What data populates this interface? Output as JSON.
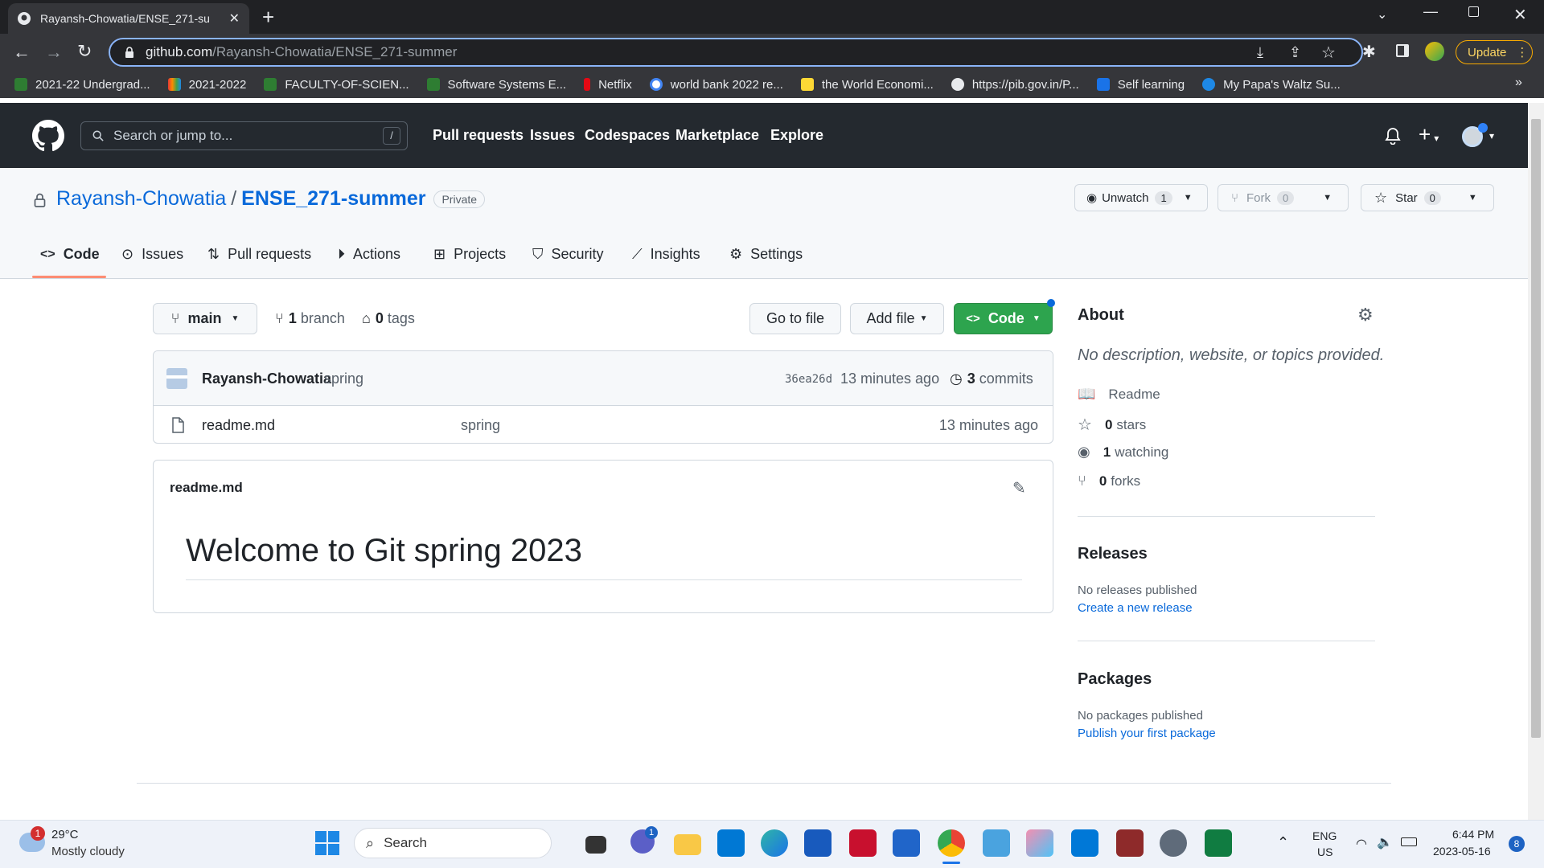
{
  "browser": {
    "tab_title": "Rayansh-Chowatia/ENSE_271-su",
    "url_host": "github.com",
    "url_path": "/Rayansh-Chowatia/ENSE_271-summer",
    "update_label": "Update",
    "bookmarks": [
      "2021-22 Undergrad...",
      "2021-2022",
      "FACULTY-OF-SCIEN...",
      "Software Systems E...",
      "Netflix",
      "world bank 2022 re...",
      "the World Economi...",
      "https://pib.gov.in/P...",
      "Self learning",
      "My Papa's Waltz Su..."
    ]
  },
  "gh": {
    "search_placeholder": "Search or jump to...",
    "search_key": "/",
    "nav": [
      "Pull requests",
      "Issues",
      "Codespaces",
      "Marketplace",
      "Explore"
    ]
  },
  "repo": {
    "owner": "Rayansh-Chowatia",
    "sep": "/",
    "name": "ENSE_271-summer",
    "visibility": "Private",
    "unwatch": "Unwatch",
    "unwatch_count": "1",
    "fork": "Fork",
    "fork_count": "0",
    "star": "Star",
    "star_count": "0",
    "tabs": [
      "Code",
      "Issues",
      "Pull requests",
      "Actions",
      "Projects",
      "Security",
      "Insights",
      "Settings"
    ]
  },
  "files": {
    "branch": "main",
    "branch_count": "1",
    "branch_word": "branch",
    "tag_count": "0",
    "tag_word": "tags",
    "go_to_file": "Go to file",
    "add_file": "Add file",
    "code_btn": "Code",
    "commit_author": "Rayansh-Chowatia",
    "commit_msg": "spring",
    "commit_hash": "36ea26d",
    "commit_time": "13 minutes ago",
    "commits_count": "3",
    "commits_word": "commits",
    "rows": [
      {
        "name": "readme.md",
        "msg": "spring",
        "time": "13 minutes ago"
      }
    ]
  },
  "readme": {
    "filename": "readme.md",
    "heading": "Welcome to Git spring 2023"
  },
  "about": {
    "title": "About",
    "desc": "No description, website, or topics provided.",
    "readme": "Readme",
    "stars_n": "0",
    "stars": "stars",
    "watching_n": "1",
    "watching": "watching",
    "forks_n": "0",
    "forks": "forks",
    "releases_title": "Releases",
    "releases_none": "No releases published",
    "releases_link": "Create a new release",
    "packages_title": "Packages",
    "packages_none": "No packages published",
    "packages_link": "Publish your first package"
  },
  "taskbar": {
    "temp": "29°C",
    "weather": "Mostly cloudy",
    "weather_badge": "1",
    "search": "Search",
    "teams_badge": "1",
    "lang1": "ENG",
    "lang2": "US",
    "time": "6:44 PM",
    "date": "2023-05-16",
    "notif": "8"
  }
}
